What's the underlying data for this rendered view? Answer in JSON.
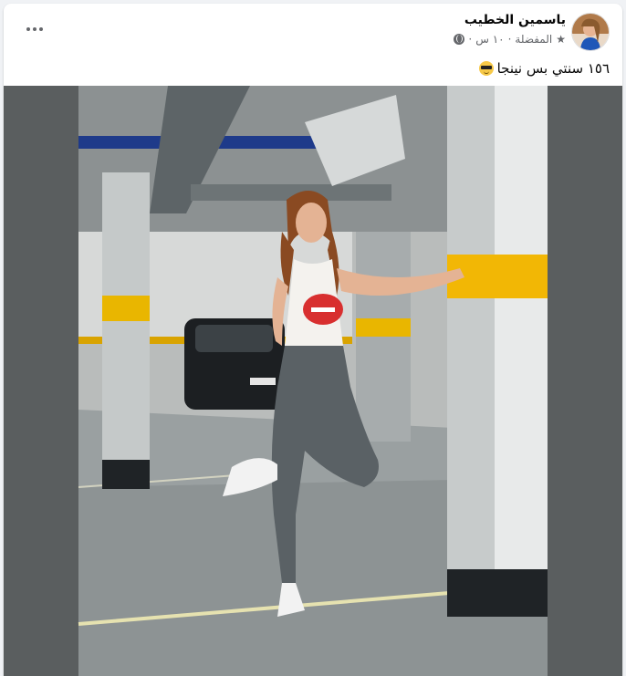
{
  "post": {
    "author": "ياسمين الخطيب",
    "audience": "المفضلة",
    "time": "١٠ س",
    "meta_separator": "·",
    "caption": "١٥٦ سنتي بس نينجا",
    "caption_emoji": "smiling-face-with-sunglasses",
    "more_icon": "more-options-icon",
    "privacy_icon": "globe-icon",
    "audience_icon": "star-icon"
  },
  "colors": {
    "page_bg": "#f0f2f5",
    "card_bg": "#ffffff",
    "text_primary": "#050505",
    "text_secondary": "#65676b",
    "pillar_yellow": "#f2b705",
    "photo_frame": "#5a5e5f"
  }
}
